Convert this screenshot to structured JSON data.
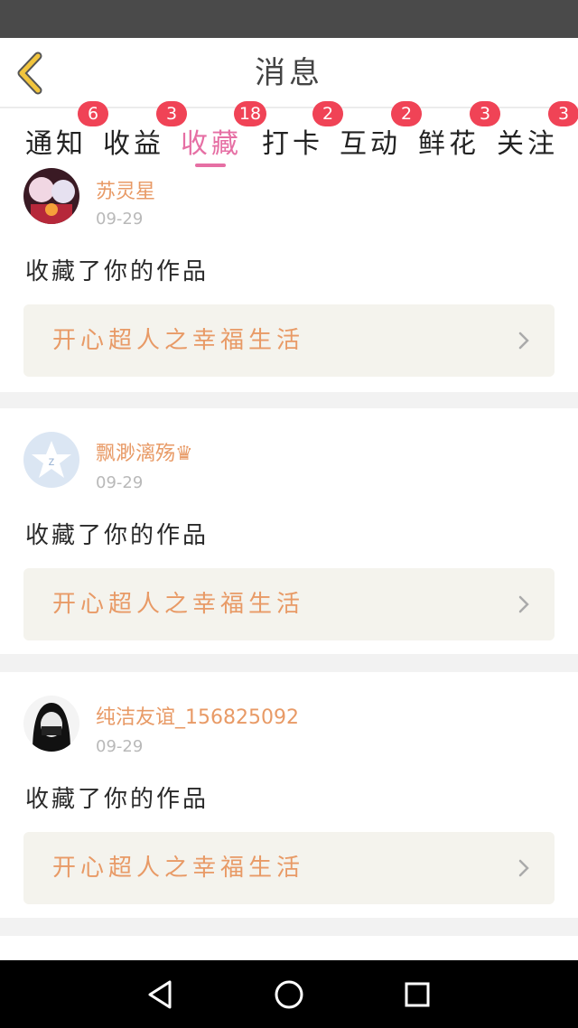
{
  "header": {
    "title": "消息"
  },
  "tabs": [
    {
      "label": "通知",
      "badge": "6"
    },
    {
      "label": "收益",
      "badge": "3"
    },
    {
      "label": "收藏",
      "badge": "18"
    },
    {
      "label": "打卡",
      "badge": "2"
    },
    {
      "label": "互动",
      "badge": "2"
    },
    {
      "label": "鲜花",
      "badge": "3"
    },
    {
      "label": "关注",
      "badge": "3"
    }
  ],
  "messages": [
    {
      "username": "苏灵星",
      "date": "09-29",
      "action": "收藏了你的作品",
      "work_title": "开心超人之幸福生活"
    },
    {
      "username": "飘渺漓殇♛",
      "date": "09-29",
      "action": "收藏了你的作品",
      "work_title": "开心超人之幸福生活"
    },
    {
      "username": "纯洁友谊_156825092",
      "date": "09-29",
      "action": "收藏了你的作品",
      "work_title": "开心超人之幸福生活"
    }
  ],
  "colors": {
    "accent_pink": "#e66fa4",
    "badge_red": "#f04356",
    "username_orange": "#e89a66",
    "back_arrow_yellow": "#f2c53d"
  },
  "icons": {
    "back": "chevron-left-icon",
    "nav_back": "triangle-back-icon",
    "nav_home": "circle-home-icon",
    "nav_recent": "square-recents-icon"
  }
}
